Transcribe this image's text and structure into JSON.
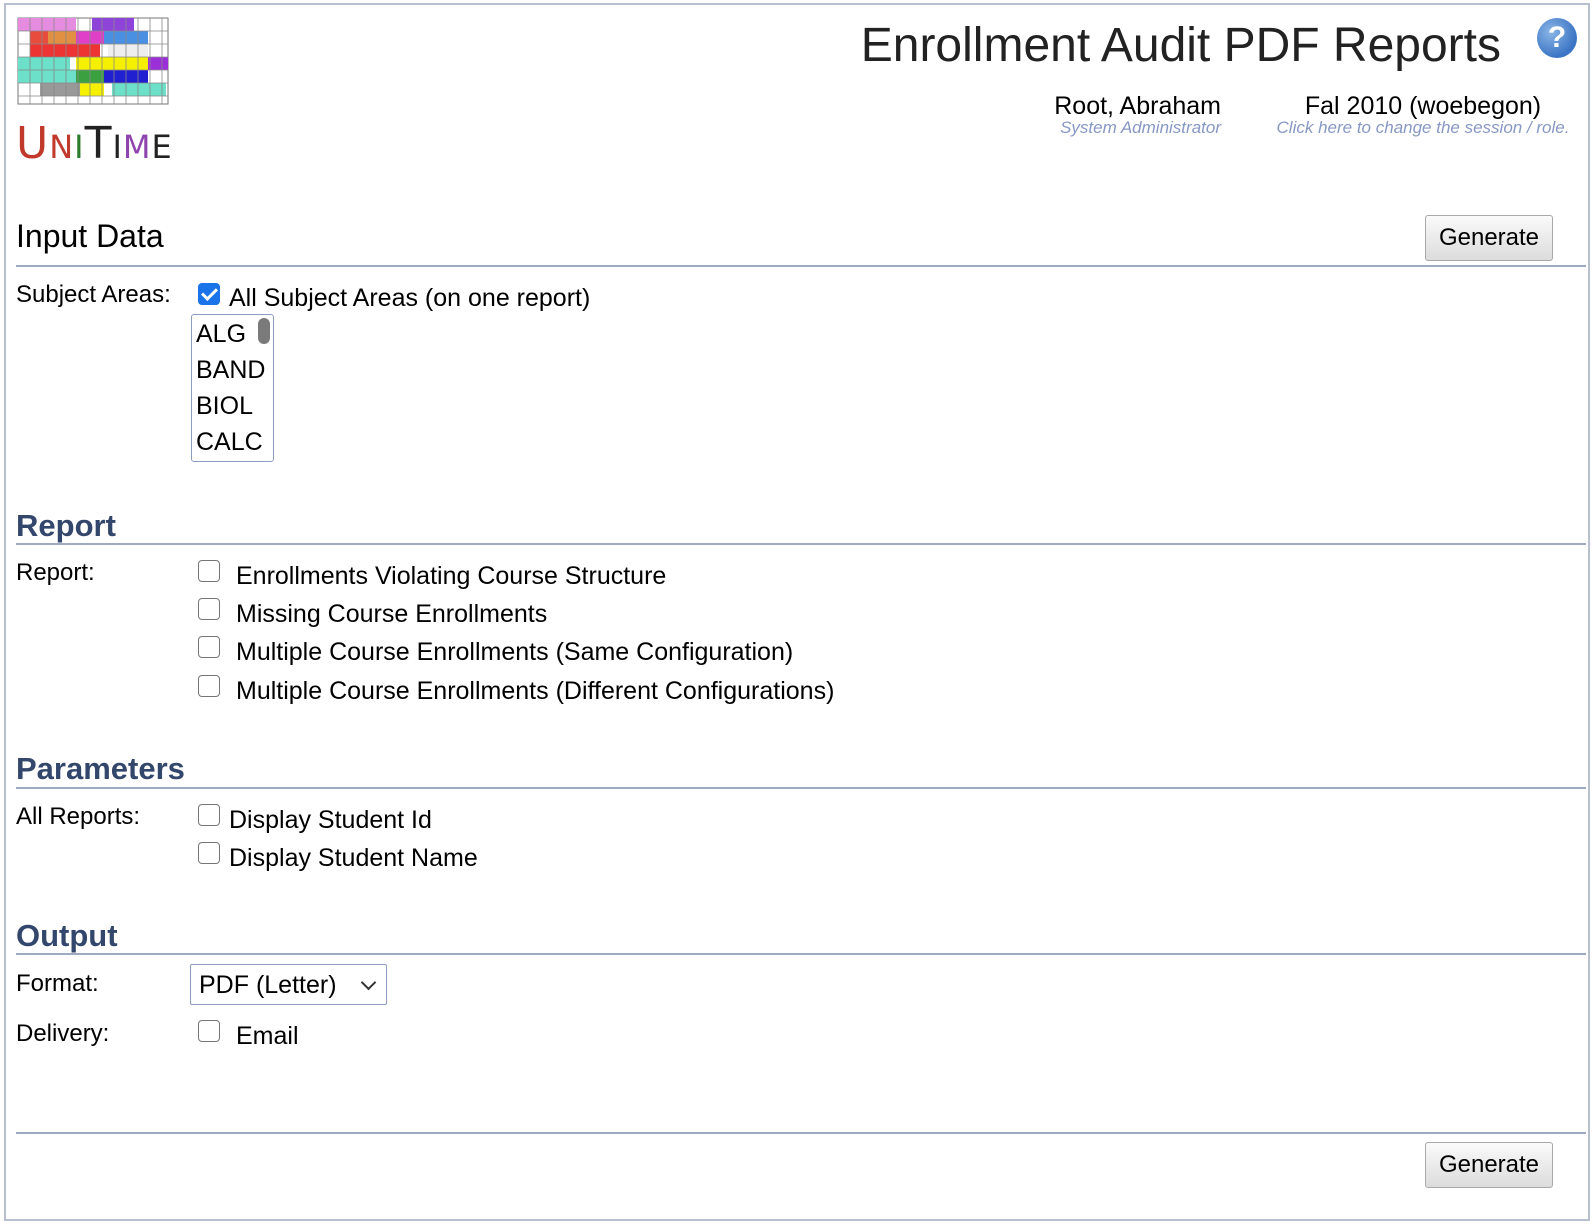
{
  "header": {
    "title": "Enrollment Audit PDF Reports",
    "help_glyph": "?",
    "user": {
      "name": "Root, Abraham",
      "role": "System Administrator"
    },
    "session": {
      "name": "Fal 2010 (woebegon)",
      "hint": "Click here to change the session / role."
    },
    "logo": {
      "letters": [
        "U",
        "N",
        "I",
        "T",
        "I",
        "M",
        "E"
      ],
      "letter_colors": [
        "#c0392b",
        "#c0392b",
        "#2c7a2c",
        "#222222",
        "#222222",
        "#8e44ad",
        "#222222"
      ]
    }
  },
  "input_data": {
    "title": "Input Data",
    "generate_label": "Generate",
    "subject_areas_label": "Subject Areas:",
    "all_subject_areas": {
      "label": "All Subject Areas (on one report)",
      "checked": true
    },
    "subject_list": [
      "ALG",
      "BAND",
      "BIOL",
      "CALC"
    ]
  },
  "report": {
    "title": "Report",
    "label": "Report:",
    "options": [
      {
        "label": "Enrollments Violating Course Structure",
        "checked": false
      },
      {
        "label": "Missing Course Enrollments",
        "checked": false
      },
      {
        "label": "Multiple Course Enrollments (Same Configuration)",
        "checked": false
      },
      {
        "label": "Multiple Course Enrollments (Different Configurations)",
        "checked": false
      }
    ]
  },
  "parameters": {
    "title": "Parameters",
    "label": "All Reports:",
    "options": [
      {
        "label": "Display Student Id",
        "checked": false
      },
      {
        "label": "Display Student Name",
        "checked": false
      }
    ]
  },
  "output": {
    "title": "Output",
    "format_label": "Format:",
    "format_value": "PDF (Letter)",
    "delivery_label": "Delivery:",
    "email": {
      "label": "Email",
      "checked": false
    }
  },
  "footer": {
    "generate_label": "Generate"
  },
  "colors": {
    "section_title": "#33466b",
    "divider": "#9eaac0",
    "hint": "#8898c4",
    "checkbox_checked": "#1a73e8"
  }
}
